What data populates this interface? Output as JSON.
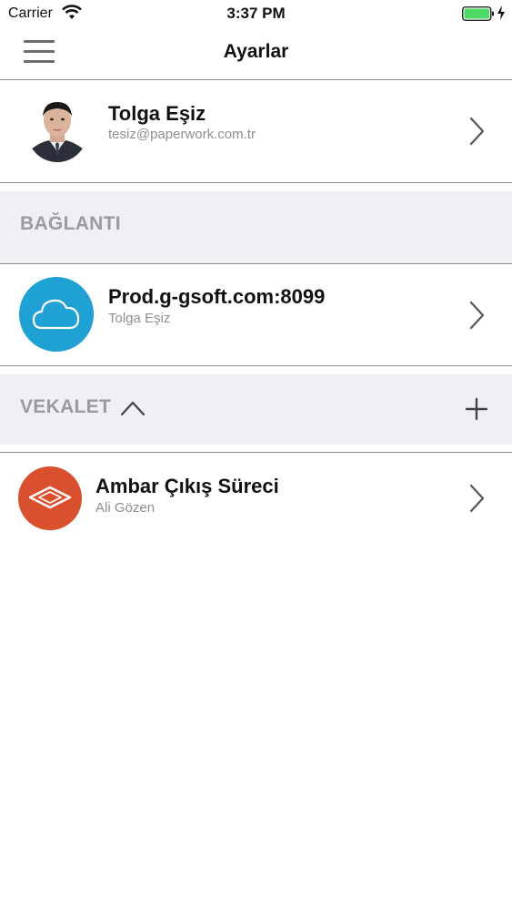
{
  "status_bar": {
    "carrier": "Carrier",
    "time": "3:37 PM",
    "battery_color": "#4cd964"
  },
  "nav": {
    "title": "Ayarlar",
    "menu_icon": "hamburger-menu-icon"
  },
  "profile": {
    "name": "Tolga Eşiz",
    "email": "tesiz@paperwork.com.tr"
  },
  "connection_section": {
    "title": "BAĞLANTI"
  },
  "connection": {
    "server": "Prod.g-gsoft.com:8099",
    "user": "Tolga Eşiz",
    "icon": "cloud-icon",
    "icon_color": "#1fa1d4"
  },
  "proxy_section": {
    "title": "VEKALET",
    "collapse_icon": "chevron-up-icon",
    "add_icon": "plus-icon"
  },
  "proxy_items": [
    {
      "title": "Ambar Çıkış Süreci",
      "subtitle": "Ali Gözen",
      "icon": "diamond-icon",
      "icon_color": "#d9502e"
    }
  ]
}
